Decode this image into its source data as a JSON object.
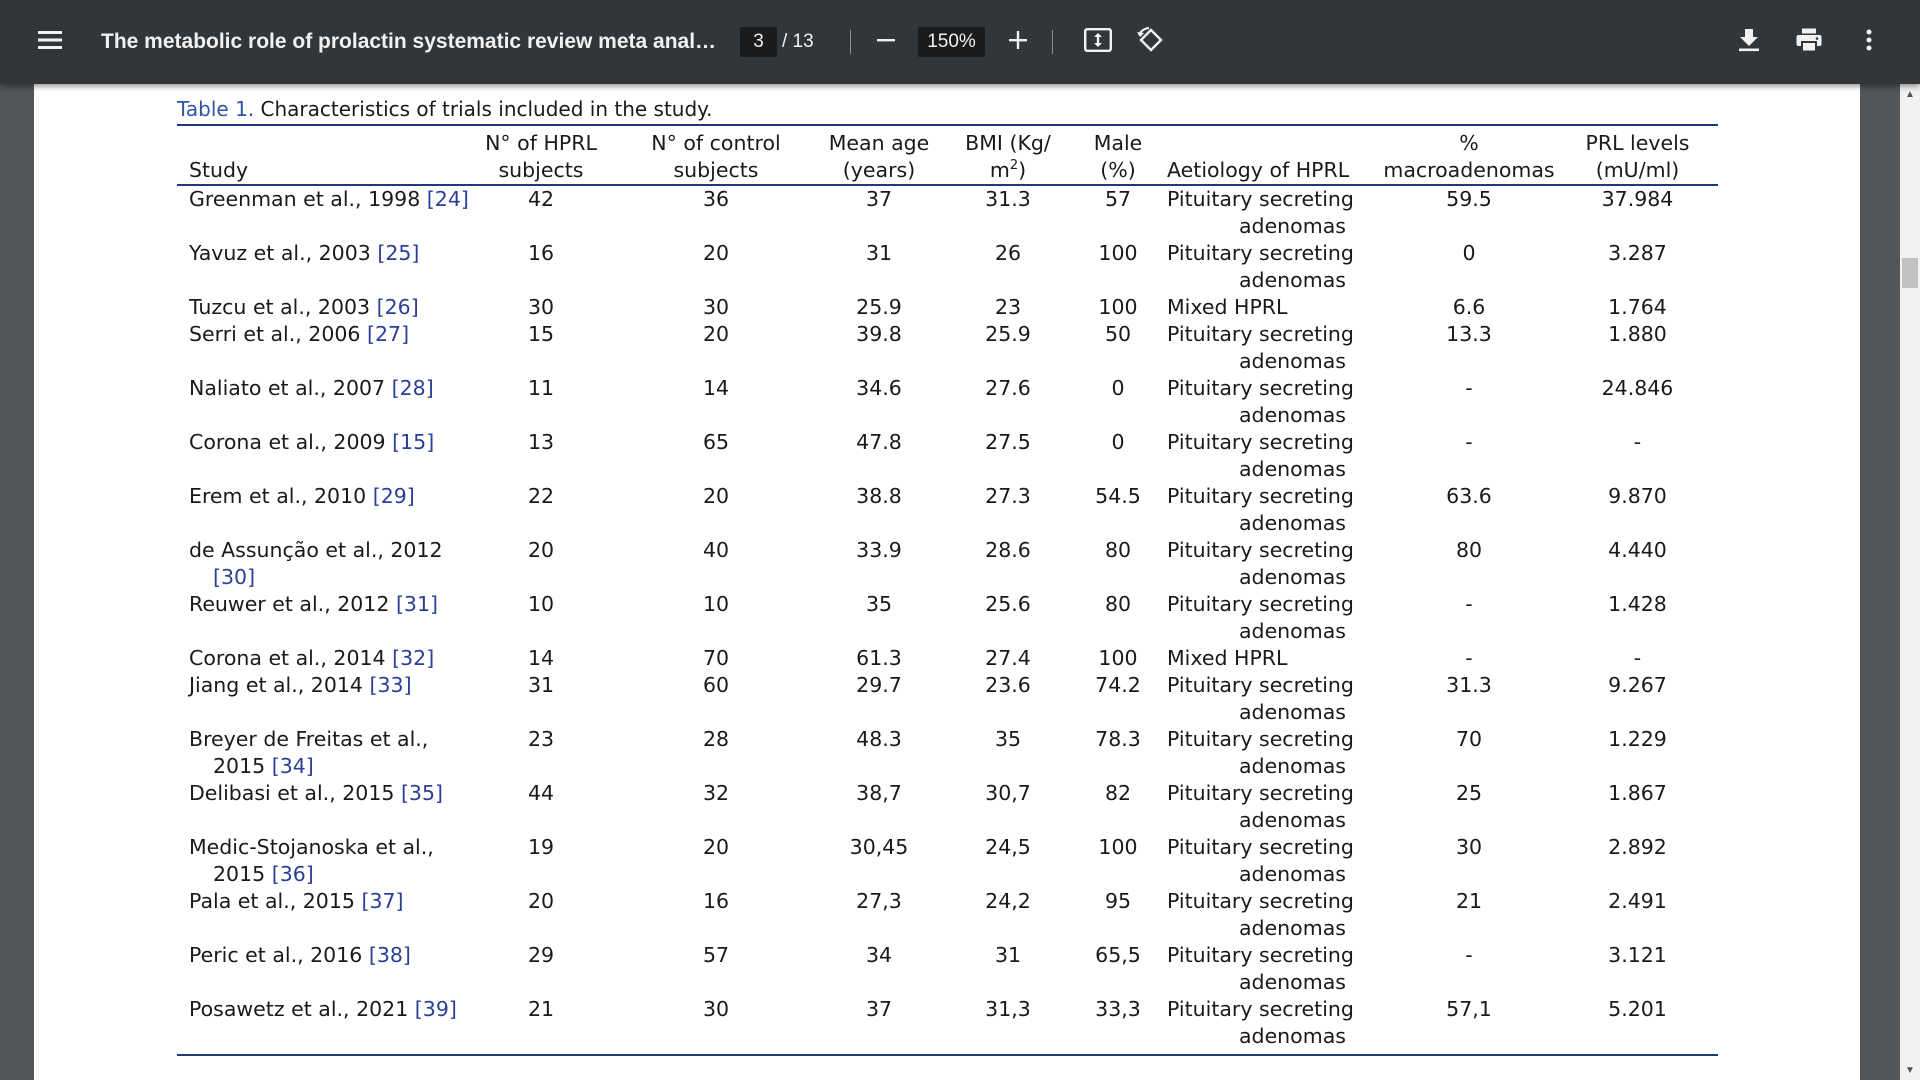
{
  "toolbar": {
    "menu_icon": "hamburger-menu-icon",
    "title": "The metabolic role of prolactin systematic review meta analysis...",
    "current_page": "3",
    "total_pages": "/ 13",
    "zoom": "150%",
    "icons": [
      "minus-icon",
      "plus-icon",
      "fit-page-icon",
      "rotate-icon",
      "download-icon",
      "print-icon",
      "more-vert-icon"
    ]
  },
  "table": {
    "caption_label": "Table 1.",
    "caption_text": "Characteristics of trials included in the study.",
    "headers": {
      "study": "Study",
      "hprl_1": "N° of HPRL",
      "hprl_2": "subjects",
      "ctrl_1": "N° of control",
      "ctrl_2": "subjects",
      "age_1": "Mean age",
      "age_2": "(years)",
      "bmi_1": "BMI (Kg/",
      "bmi_2": "m",
      "bmi_sup": "2",
      "bmi_3": ")",
      "male_1": "Male",
      "male_2": "(%)",
      "aetiology": "Aetiology of HPRL",
      "macro_1": "%",
      "macro_2": "macroadenomas",
      "prl_1": "PRL levels",
      "prl_2": "(mU/ml)"
    },
    "rows": [
      {
        "study": "Greenman et al., 1998",
        "ref": "[24]",
        "hprl": "42",
        "ctrl": "36",
        "age": "37",
        "bmi": "31.3",
        "male": "57",
        "aet": "Pituitary secreting adenomas",
        "macro": "59.5",
        "prl": "37.984"
      },
      {
        "study": "Yavuz et al., 2003",
        "ref": "[25]",
        "hprl": "16",
        "ctrl": "20",
        "age": "31",
        "bmi": "26",
        "male": "100",
        "aet": "Pituitary secreting adenomas",
        "macro": "0",
        "prl": "3.287"
      },
      {
        "study": "Tuzcu et al., 2003",
        "ref": "[26]",
        "hprl": "30",
        "ctrl": "30",
        "age": "25.9",
        "bmi": "23",
        "male": "100",
        "aet": "Mixed HPRL",
        "macro": "6.6",
        "prl": "1.764"
      },
      {
        "study": "Serri et al., 2006",
        "ref": "[27]",
        "hprl": "15",
        "ctrl": "20",
        "age": "39.8",
        "bmi": "25.9",
        "male": "50",
        "aet": "Pituitary secreting adenomas",
        "macro": "13.3",
        "prl": "1.880"
      },
      {
        "study": "Naliato et al., 2007",
        "ref": "[28]",
        "hprl": "11",
        "ctrl": "14",
        "age": "34.6",
        "bmi": "27.6",
        "male": "0",
        "aet": "Pituitary secreting adenomas",
        "macro": "-",
        "prl": "24.846"
      },
      {
        "study": "Corona et al., 2009",
        "ref": "[15]",
        "hprl": "13",
        "ctrl": "65",
        "age": "47.8",
        "bmi": "27.5",
        "male": "0",
        "aet": "Pituitary secreting adenomas",
        "macro": "-",
        "prl": "-"
      },
      {
        "study": "Erem et al., 2010",
        "ref": "[29]",
        "hprl": "22",
        "ctrl": "20",
        "age": "38.8",
        "bmi": "27.3",
        "male": "54.5",
        "aet": "Pituitary secreting adenomas",
        "macro": "63.6",
        "prl": "9.870"
      },
      {
        "study": "de Assunção et al., 2012",
        "ref": "[30]",
        "hprl": "20",
        "ctrl": "40",
        "age": "33.9",
        "bmi": "28.6",
        "male": "80",
        "aet": "Pituitary secreting adenomas",
        "macro": "80",
        "prl": "4.440"
      },
      {
        "study": "Reuwer et al., 2012",
        "ref": "[31]",
        "hprl": "10",
        "ctrl": "10",
        "age": "35",
        "bmi": "25.6",
        "male": "80",
        "aet": "Pituitary secreting adenomas",
        "macro": "-",
        "prl": "1.428"
      },
      {
        "study": "Corona et al., 2014",
        "ref": "[32]",
        "hprl": "14",
        "ctrl": "70",
        "age": "61.3",
        "bmi": "27.4",
        "male": "100",
        "aet": "Mixed HPRL",
        "macro": "-",
        "prl": "-"
      },
      {
        "study": "Jiang et al., 2014",
        "ref": "[33]",
        "hprl": "31",
        "ctrl": "60",
        "age": "29.7",
        "bmi": "23.6",
        "male": "74.2",
        "aet": "Pituitary secreting adenomas",
        "macro": "31.3",
        "prl": "9.267"
      },
      {
        "study": "Breyer de Freitas et al., 2015",
        "ref": "[34]",
        "hprl": "23",
        "ctrl": "28",
        "age": "48.3",
        "bmi": "35",
        "male": "78.3",
        "aet": "Pituitary secreting adenomas",
        "macro": "70",
        "prl": "1.229"
      },
      {
        "study": "Delibasi et al., 2015",
        "ref": "[35]",
        "hprl": "44",
        "ctrl": "32",
        "age": "38,7",
        "bmi": "30,7",
        "male": "82",
        "aet": "Pituitary secreting adenomas",
        "macro": "25",
        "prl": "1.867"
      },
      {
        "study": "Medic-Stojanoska et al., 2015",
        "ref": "[36]",
        "hprl": "19",
        "ctrl": "20",
        "age": "30,45",
        "bmi": "24,5",
        "male": "100",
        "aet": "Pituitary secreting adenomas",
        "macro": "30",
        "prl": "2.892"
      },
      {
        "study": "Pala et al., 2015",
        "ref": "[37]",
        "hprl": "20",
        "ctrl": "16",
        "age": "27,3",
        "bmi": "24,2",
        "male": "95",
        "aet": "Pituitary secreting adenomas",
        "macro": "21",
        "prl": "2.491"
      },
      {
        "study": "Peric et al., 2016",
        "ref": "[38]",
        "hprl": "29",
        "ctrl": "57",
        "age": "34",
        "bmi": "31",
        "male": "65,5",
        "aet": "Pituitary secreting adenomas",
        "macro": "-",
        "prl": "3.121"
      },
      {
        "study": "Posawetz et al., 2021",
        "ref": "[39]",
        "hprl": "21",
        "ctrl": "30",
        "age": "37",
        "bmi": "31,3",
        "male": "33,3",
        "aet": "Pituitary secreting adenomas",
        "macro": "57,1",
        "prl": "5.201"
      }
    ]
  },
  "colors": {
    "toolbar_bg": "#323639",
    "viewer_bg": "#525659",
    "rule": "#1f3a7a",
    "link": "#2b3f99",
    "table_label": "#2f55a4"
  }
}
